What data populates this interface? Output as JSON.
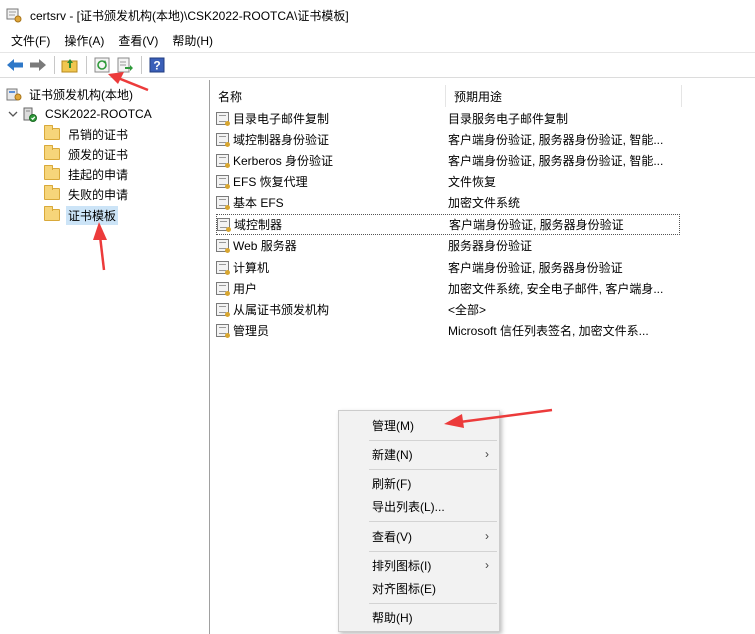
{
  "window": {
    "title": "certsrv - [证书颁发机构(本地)\\CSK2022-ROOTCA\\证书模板]"
  },
  "menubar": {
    "file": "文件(F)",
    "action": "操作(A)",
    "view": "查看(V)",
    "help": "帮助(H)"
  },
  "toolbar": {
    "buttons": [
      "back-arrow-icon",
      "forward-arrow-icon",
      "up-folder-icon",
      "refresh-icon",
      "export-list-icon",
      "help-icon"
    ],
    "help_glyph": "?"
  },
  "tree": {
    "root": "证书颁发机构(本地)",
    "ca": "CSK2022-ROOTCA",
    "items": [
      "吊销的证书",
      "颁发的证书",
      "挂起的申请",
      "失败的申请",
      "证书模板"
    ],
    "selected": "证书模板"
  },
  "list": {
    "columns": {
      "name": "名称",
      "purpose": "预期用途"
    },
    "rows": [
      {
        "name": "目录电子邮件复制",
        "purpose": "目录服务电子邮件复制"
      },
      {
        "name": "域控制器身份验证",
        "purpose": "客户端身份验证, 服务器身份验证, 智能..."
      },
      {
        "name": "Kerberos 身份验证",
        "purpose": "客户端身份验证, 服务器身份验证, 智能..."
      },
      {
        "name": "EFS 恢复代理",
        "purpose": "文件恢复"
      },
      {
        "name": "基本 EFS",
        "purpose": "加密文件系统"
      },
      {
        "name": "域控制器",
        "purpose": "客户端身份验证, 服务器身份验证"
      },
      {
        "name": "Web 服务器",
        "purpose": "服务器身份验证"
      },
      {
        "name": "计算机",
        "purpose": "客户端身份验证, 服务器身份验证"
      },
      {
        "name": "用户",
        "purpose": "加密文件系统, 安全电子邮件, 客户端身..."
      },
      {
        "name": "从属证书颁发机构",
        "purpose": "<全部>"
      },
      {
        "name": "管理员",
        "purpose": "Microsoft 信任列表签名, 加密文件系..."
      }
    ]
  },
  "context_menu": {
    "manage": "管理(M)",
    "new": "新建(N)",
    "refresh": "刷新(F)",
    "export_list": "导出列表(L)...",
    "view": "查看(V)",
    "arrange_icons": "排列图标(I)",
    "align_icons": "对齐图标(E)",
    "help": "帮助(H)",
    "submenu_arrow": "›"
  },
  "colors": {
    "annotation_arrow": "#ec3b3b",
    "selection": "#cce4f7",
    "back_arrow": "#2f78c8",
    "forward_arrow": "#7a7a7a"
  }
}
